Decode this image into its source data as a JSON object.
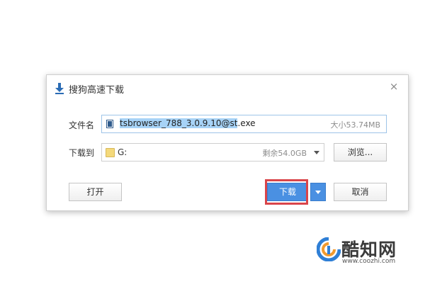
{
  "dialog": {
    "title": "搜狗高速下载",
    "close_symbol": "×",
    "filename_label": "文件名",
    "filename_selected": "tsbrowser_788_3.0.9.10@st",
    "filename_rest": ".exe",
    "filesize": "大小53.74MB",
    "saveto_label": "下载到",
    "folder_path": "G:",
    "free_space": "剩余54.0GB",
    "browse_label": "浏览...",
    "open_label": "打开",
    "download_label": "下载",
    "cancel_label": "取消"
  },
  "watermark": {
    "brand": "酷知网",
    "url": "www.coozhi.com"
  },
  "colors": {
    "accent": "#4a90e2",
    "highlight": "#d9454a",
    "selection": "#a7d3f7"
  }
}
